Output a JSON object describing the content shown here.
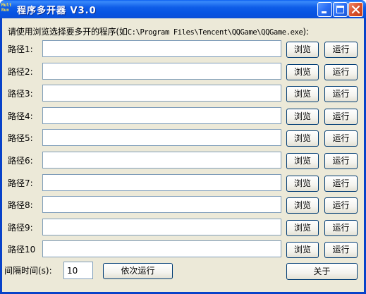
{
  "window": {
    "title": "程序多开器 V3.0",
    "icon_text_top": "Mult",
    "icon_text_bottom": "Run"
  },
  "instruction": {
    "prefix": "请使用浏览选择要多开的程序(如",
    "example": "C:\\Program Files\\Tencent\\QQGame\\QQGame.exe",
    "suffix": "):"
  },
  "rows": [
    {
      "label": "路径1:",
      "value": "",
      "browse_label": "浏览",
      "run_label": "运行"
    },
    {
      "label": "路径2:",
      "value": "",
      "browse_label": "浏览",
      "run_label": "运行"
    },
    {
      "label": "路径3:",
      "value": "",
      "browse_label": "浏览",
      "run_label": "运行"
    },
    {
      "label": "路径4:",
      "value": "",
      "browse_label": "浏览",
      "run_label": "运行"
    },
    {
      "label": "路径5:",
      "value": "",
      "browse_label": "浏览",
      "run_label": "运行"
    },
    {
      "label": "路径6:",
      "value": "",
      "browse_label": "浏览",
      "run_label": "运行"
    },
    {
      "label": "路径7:",
      "value": "",
      "browse_label": "浏览",
      "run_label": "运行"
    },
    {
      "label": "路径8:",
      "value": "",
      "browse_label": "浏览",
      "run_label": "运行"
    },
    {
      "label": "路径9:",
      "value": "",
      "browse_label": "浏览",
      "run_label": "运行"
    },
    {
      "label": "路径10",
      "value": "",
      "browse_label": "浏览",
      "run_label": "运行"
    }
  ],
  "footer": {
    "interval_label": "间隔时间(s):",
    "interval_value": "10",
    "sequential_run_label": "依次运行",
    "about_label": "关于"
  },
  "icons": {
    "app": "multirun-app-icon",
    "minimize": "minimize-icon",
    "maximize": "maximize-icon",
    "close": "close-icon"
  },
  "colors": {
    "titlebar": "#0654e3",
    "close_button": "#d9512c",
    "window_face": "#ece9d8",
    "input_border": "#7f9db9"
  }
}
